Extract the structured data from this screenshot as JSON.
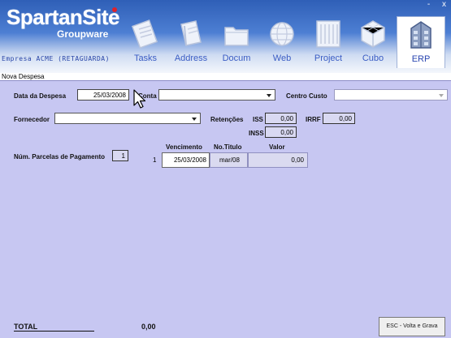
{
  "app": {
    "logo_main": "SpartanSite",
    "logo_sub": "Groupware",
    "company": "Empresa ACME (RETAGUARDA)",
    "window_controls": [
      "-",
      "x"
    ]
  },
  "modules": [
    {
      "label": "Tasks",
      "icon": "tasks-icon"
    },
    {
      "label": "Address",
      "icon": "address-book-icon"
    },
    {
      "label": "Docum",
      "icon": "folder-icon"
    },
    {
      "label": "Web",
      "icon": "globe-icon"
    },
    {
      "label": "Project",
      "icon": "project-building-icon"
    },
    {
      "label": "Cubo",
      "icon": "cube-icon"
    },
    {
      "label": "ERP",
      "icon": "erp-building-icon",
      "active": true
    }
  ],
  "menubar": {
    "title": "Nova Despesa"
  },
  "form": {
    "data_label": "Data da Despesa",
    "data_value": "25/03/2008",
    "conta_label": "Conta",
    "conta_value": "",
    "centro_label": "Centro Custo",
    "centro_value": "",
    "fornecedor_label": "Fornecedor",
    "fornecedor_value": "",
    "retencoes_label": "Retenções",
    "iss_label": "ISS",
    "iss_value": "0,00",
    "irrf_label": "IRRF",
    "irrf_value": "0,00",
    "inss_label": "INSS",
    "inss_value": "0,00",
    "parcelas_label": "Núm. Parcelas de Pagamento",
    "parcelas_value": "1"
  },
  "installments": {
    "headers": {
      "vencimento": "Vencimento",
      "titulo": "No.Titulo",
      "valor": "Valor"
    },
    "rows": [
      {
        "num": "1",
        "vencimento": "25/03/2008",
        "titulo": "mar/08",
        "valor": "0,00"
      }
    ]
  },
  "footer": {
    "total_label": "TOTAL",
    "total_value": "0,00",
    "esc_button": "ESC - Volta e Grava"
  },
  "colors": {
    "background": "#c7c7f2",
    "header_blue": "#2f5fb7",
    "link_blue": "#3a5cc4"
  }
}
